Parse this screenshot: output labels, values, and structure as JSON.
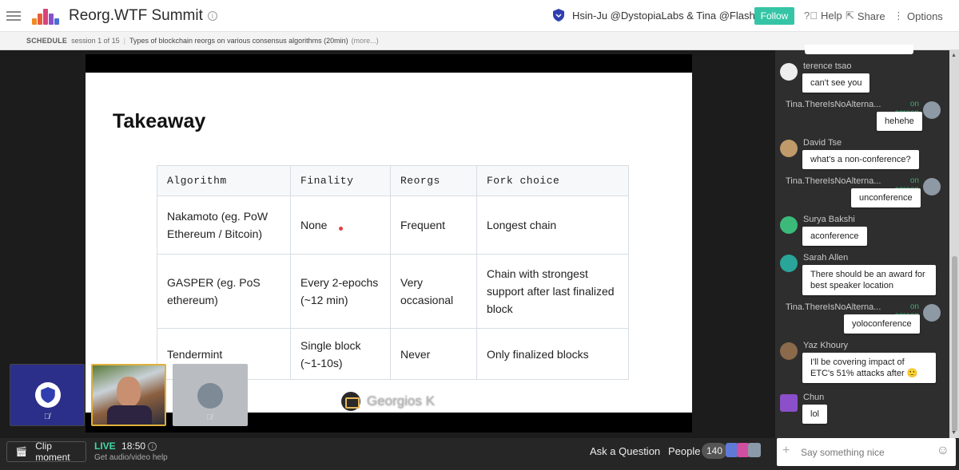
{
  "header": {
    "title": "Reorg.WTF Summit",
    "presenters": "Hsin-Ju @DystopiaLabs & Tina @Flashb...",
    "follow_label": "Follow",
    "help_label": "Help",
    "share_label": "Share",
    "options_label": "Options"
  },
  "schedule": {
    "label": "SCHEDULE",
    "session": "session 1 of 15",
    "topic": "Types of blockchain reorgs on various consensus algorithms (20min)",
    "more": "(more...)"
  },
  "slide": {
    "title": "Takeaway",
    "headers": [
      "Algorithm",
      "Finality",
      "Reorgs",
      "Fork choice"
    ],
    "rows": [
      [
        "Nakamoto (eg. PoW Ethereum / Bitcoin)",
        "None",
        "Frequent",
        "Longest chain"
      ],
      [
        "GASPER (eg. PoS ethereum)",
        "Every 2-epochs (~12 min)",
        "Very occasional",
        "Chain with strongest support after last finalized block"
      ],
      [
        "Tendermint",
        "Single block (~1-10s)",
        "Never",
        "Only finalized blocks"
      ]
    ],
    "speaker_name": "Georgios K"
  },
  "bottom": {
    "clip_label": "Clip moment",
    "live_tag": "LIVE",
    "live_time": "18:50",
    "help_text": "Get audio/video help",
    "ask_label": "Ask a Question",
    "people_label": "People",
    "people_count": "140"
  },
  "chat": {
    "on_screen_label": "on screen",
    "messages": [
      {
        "name": "terence tsao",
        "text": "can't see you"
      },
      {
        "name": "Tina.ThereIsNoAlterna...",
        "text": "hehehe"
      },
      {
        "name": "David Tse",
        "text": "what's a non-conference?"
      },
      {
        "name": "Tina.ThereIsNoAlterna...",
        "text": "unconference"
      },
      {
        "name": "Surya Bakshi",
        "text": "aconference"
      },
      {
        "name": "Sarah Allen",
        "text": "There should be an award for best speaker location"
      },
      {
        "name": "Tina.ThereIsNoAlterna...",
        "text": "yoloconference"
      },
      {
        "name": "Yaz Khoury",
        "text": "I'll be covering impact of ETC's 51% attacks after 🙂"
      },
      {
        "name": "Chun",
        "text": "lol"
      }
    ],
    "input_placeholder": "Say something nice"
  },
  "colors": {
    "accent": "#35c5a6",
    "live": "#3fd9a7",
    "on_screen": "#3cae6f"
  }
}
